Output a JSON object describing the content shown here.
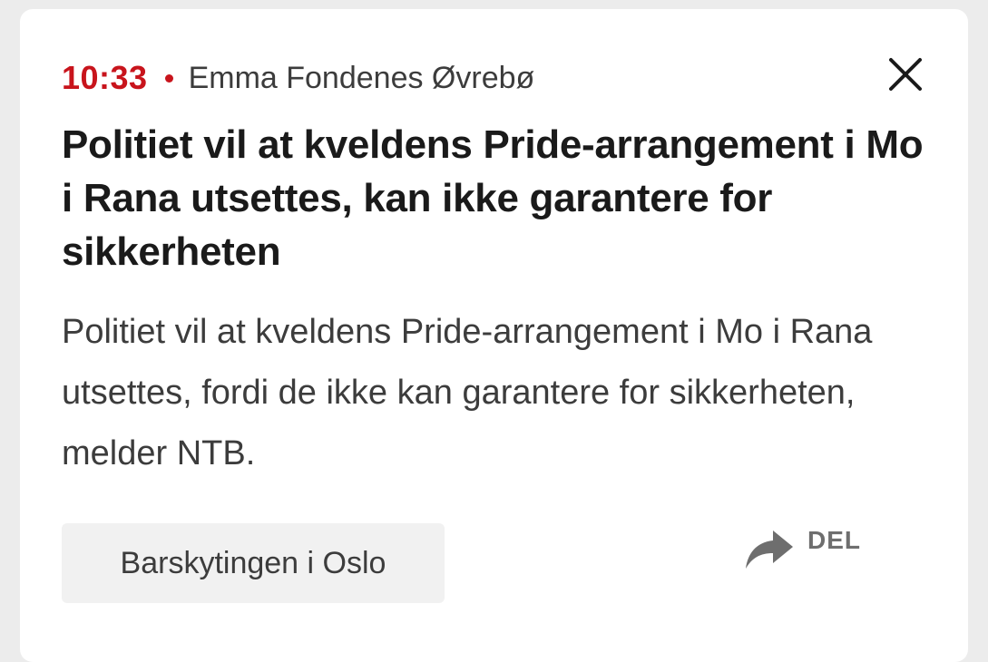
{
  "article": {
    "time": "10:33",
    "author": "Emma Fondenes Øvrebø",
    "headline": "Politiet vil at kveldens Pride-arrangement i Mo i Rana utsettes, kan ikke garantere for sikkerheten",
    "body": "Politiet vil at kveldens Pride-arrangement i Mo i Rana utsettes, fordi de ikke kan garantere for sikkerheten, melder NTB."
  },
  "tag": {
    "label": "Barskytingen i Oslo"
  },
  "share": {
    "label": "DEL",
    "icon": "share-arrow-icon"
  },
  "close": {
    "icon": "close-icon"
  },
  "colors": {
    "accent": "#c8141c",
    "text": "#1a1a1a",
    "muted": "#3c3c3c",
    "tag_bg": "#f1f1f1"
  }
}
